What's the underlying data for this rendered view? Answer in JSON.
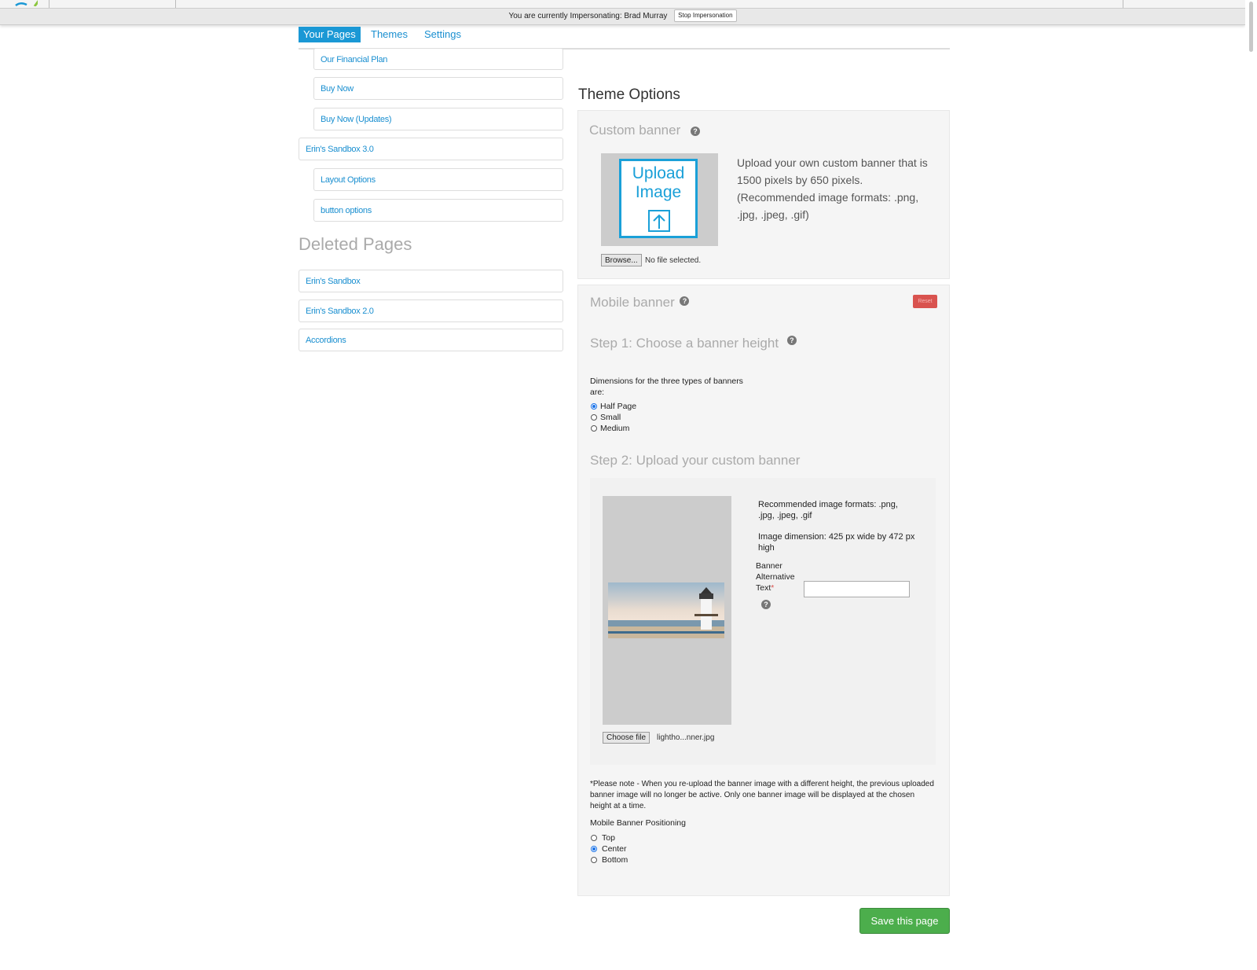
{
  "impersonation": {
    "message": "You are currently Impersonating: Brad Murray",
    "stop_label": "Stop Impersonation"
  },
  "tabs": [
    {
      "label": "Your Pages",
      "active": true
    },
    {
      "label": "Themes",
      "active": false
    },
    {
      "label": "Settings",
      "active": false
    }
  ],
  "pages": [
    {
      "label": "Our Financial Plan",
      "indent": true
    },
    {
      "label": "Buy Now",
      "indent": true
    },
    {
      "label": "Buy Now (Updates)",
      "indent": true
    },
    {
      "label": "Erin's Sandbox 3.0",
      "indent": false
    },
    {
      "label": "Layout Options",
      "indent": true
    },
    {
      "label": "button options",
      "indent": true
    }
  ],
  "deleted": {
    "title": "Deleted Pages",
    "items": [
      "Erin's Sandbox",
      "Erin's Sandbox 2.0",
      "Accordions"
    ]
  },
  "theme_options": {
    "title": "Theme Options",
    "custom_banner": {
      "heading": "Custom banner",
      "upload_text": "Upload Image",
      "description": "Upload your own custom banner that is 1500 pixels by 650 pixels. (Recommended image formats: .png, .jpg, .jpeg, .gif)",
      "browse_label": "Browse...",
      "no_file": "No file selected."
    },
    "mobile_banner": {
      "heading": "Mobile banner",
      "reset_label": "Reset",
      "step1_heading": "Step 1: Choose a banner height",
      "dimensions_text": "Dimensions for the three types of banners are:",
      "heights": [
        {
          "label": "Half Page",
          "checked": true
        },
        {
          "label": "Small",
          "checked": false
        },
        {
          "label": "Medium",
          "checked": false
        }
      ],
      "step2_heading": "Step 2: Upload your custom banner",
      "formats_text": "Recommended image formats: .png, .jpg, .jpeg, .gif",
      "dimension_text": "Image dimension: 425 px wide by 472 px high",
      "alt_label": "Banner Alternative Text",
      "alt_required": "*",
      "alt_value": "",
      "choose_label": "Choose file",
      "file_name": "lightho...nner.jpg",
      "note": "*Please note - When you re-upload the banner image with a different height, the previous uploaded banner image will no longer be active. Only one banner image will be displayed at the chosen height at a time.",
      "positioning_label": "Mobile Banner Positioning",
      "positions": [
        {
          "label": "Top",
          "checked": false
        },
        {
          "label": "Center",
          "checked": true
        },
        {
          "label": "Bottom",
          "checked": false
        }
      ]
    }
  },
  "save_label": "Save this page",
  "help_glyph": "?",
  "colors": {
    "accent": "#1a98d5",
    "link": "#1a8fd0",
    "save": "#4cae4c",
    "reset": "#d9534f"
  }
}
